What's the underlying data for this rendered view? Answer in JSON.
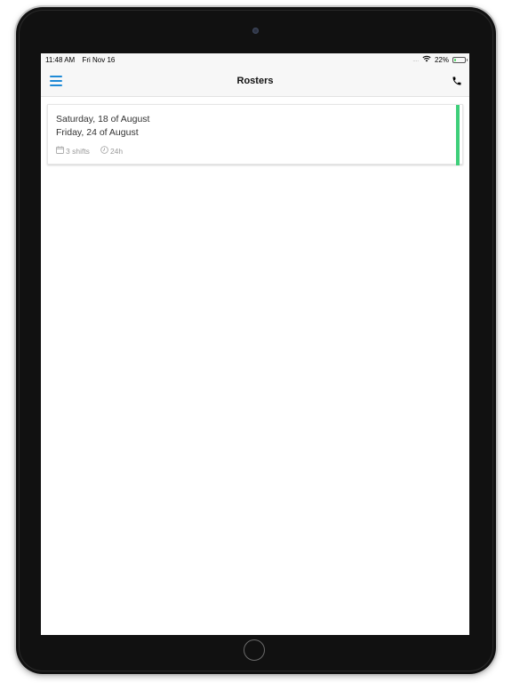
{
  "status_bar": {
    "time": "11:48 AM",
    "date": "Fri Nov 16",
    "signal": "....",
    "battery_percent": "22%",
    "battery_level": 0.22,
    "battery_color": "#4cd964"
  },
  "nav": {
    "title": "Rosters",
    "menu_icon": "hamburger-menu-icon",
    "phone_icon": "phone-icon",
    "accent_color": "#1f8ad6"
  },
  "rosters": [
    {
      "start": "Saturday, 18 of August",
      "end": "Friday, 24 of August",
      "shifts": "3 shifts",
      "hours": "24h",
      "status_color": "#3ecf7a"
    }
  ]
}
